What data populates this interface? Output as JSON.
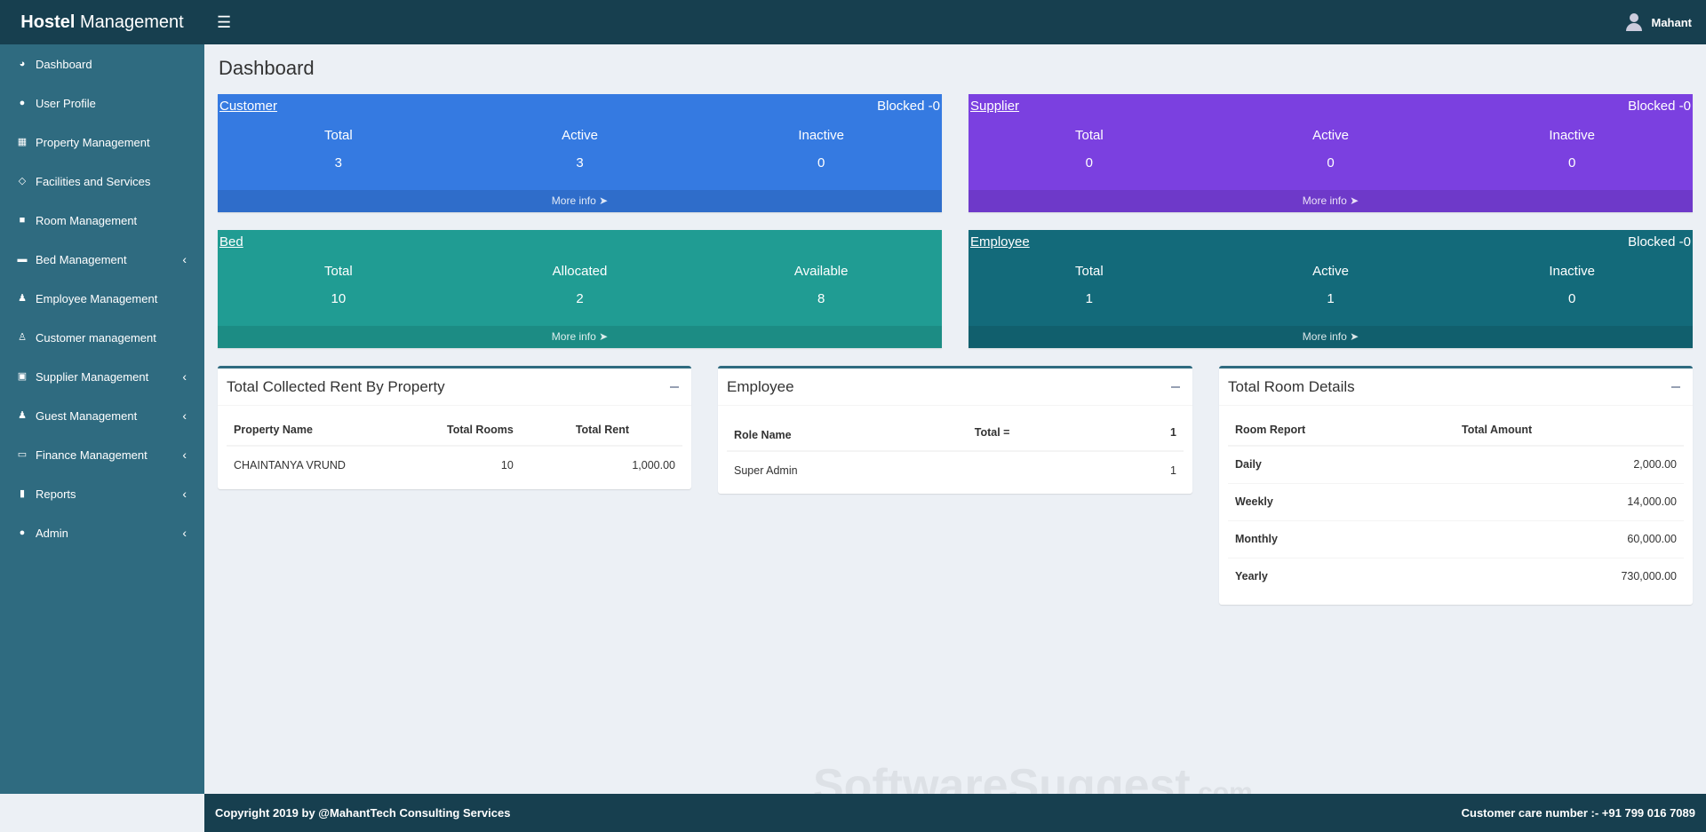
{
  "header": {
    "brand_bold": "Hostel",
    "brand_rest": "Management",
    "user": "Mahant"
  },
  "sidebar": {
    "items": [
      {
        "label": "Dashboard",
        "icon": "dashboard-icon",
        "glyph": "◕"
      },
      {
        "label": "User Profile",
        "icon": "user-icon",
        "glyph": "●"
      },
      {
        "label": "Property Management",
        "icon": "building-icon",
        "glyph": "▦"
      },
      {
        "label": "Facilities and Services",
        "icon": "handshake-icon",
        "glyph": "◇"
      },
      {
        "label": "Room Management",
        "icon": "square-icon",
        "glyph": "■"
      },
      {
        "label": "Bed Management",
        "icon": "bed-icon",
        "glyph": "▬",
        "chevron": true
      },
      {
        "label": "Employee Management",
        "icon": "users-icon",
        "glyph": "♟"
      },
      {
        "label": "Customer management",
        "icon": "user-plus-icon",
        "glyph": "♙"
      },
      {
        "label": "Supplier Management",
        "icon": "cubes-icon",
        "glyph": "▣",
        "chevron": true
      },
      {
        "label": "Guest Management",
        "icon": "users-icon",
        "glyph": "♟",
        "chevron": true
      },
      {
        "label": "Finance Management",
        "icon": "money-icon",
        "glyph": "▭",
        "chevron": true
      },
      {
        "label": "Reports",
        "icon": "file-icon",
        "glyph": "▮",
        "chevron": true
      },
      {
        "label": "Admin",
        "icon": "user-icon",
        "glyph": "●",
        "chevron": true
      }
    ]
  },
  "page_title": "Dashboard",
  "stat_boxes": {
    "customer": {
      "title": "Customer",
      "blocked": "Blocked -0",
      "labels": [
        "Total",
        "Active",
        "Inactive"
      ],
      "values": [
        "3",
        "3",
        "0"
      ],
      "more": "More info",
      "color": "#357ae1"
    },
    "supplier": {
      "title": "Supplier",
      "blocked": "Blocked -0",
      "labels": [
        "Total",
        "Active",
        "Inactive"
      ],
      "values": [
        "0",
        "0",
        "0"
      ],
      "more": "More info",
      "color": "#7b40e0"
    },
    "bed": {
      "title": "Bed",
      "blocked": "",
      "labels": [
        "Total",
        "Allocated",
        "Available"
      ],
      "values": [
        "10",
        "2",
        "8"
      ],
      "more": "More info",
      "color": "#209c93"
    },
    "employee": {
      "title": "Employee",
      "blocked": "Blocked -0",
      "labels": [
        "Total",
        "Active",
        "Inactive"
      ],
      "values": [
        "1",
        "1",
        "0"
      ],
      "more": "More info",
      "color": "#136a7a"
    }
  },
  "rent": {
    "title": "Total Collected Rent By Property",
    "headers": [
      "Property Name",
      "Total Rooms",
      "Total Rent"
    ],
    "rows": [
      [
        "CHAINTANYA VRUND",
        "10",
        "1,000.00"
      ]
    ]
  },
  "employee_box": {
    "title": "Employee",
    "headers": [
      "Role Name",
      "Total =",
      "1"
    ],
    "rows": [
      [
        "Super Admin",
        "",
        "1"
      ]
    ]
  },
  "room": {
    "title": "Total Room Details",
    "headers": [
      "Room Report",
      "Total Amount"
    ],
    "rows": [
      [
        "Daily",
        "2,000.00"
      ],
      [
        "Weekly",
        "14,000.00"
      ],
      [
        "Monthly",
        "60,000.00"
      ],
      [
        "Yearly",
        "730,000.00"
      ]
    ]
  },
  "footer": {
    "copyright": "Copyright 2019 by @MahantTech Consulting Services",
    "care": "Customer care number :- +91 799 016 7089"
  },
  "watermark": {
    "main": "SoftwareSuggest",
    "suffix": ".com"
  }
}
